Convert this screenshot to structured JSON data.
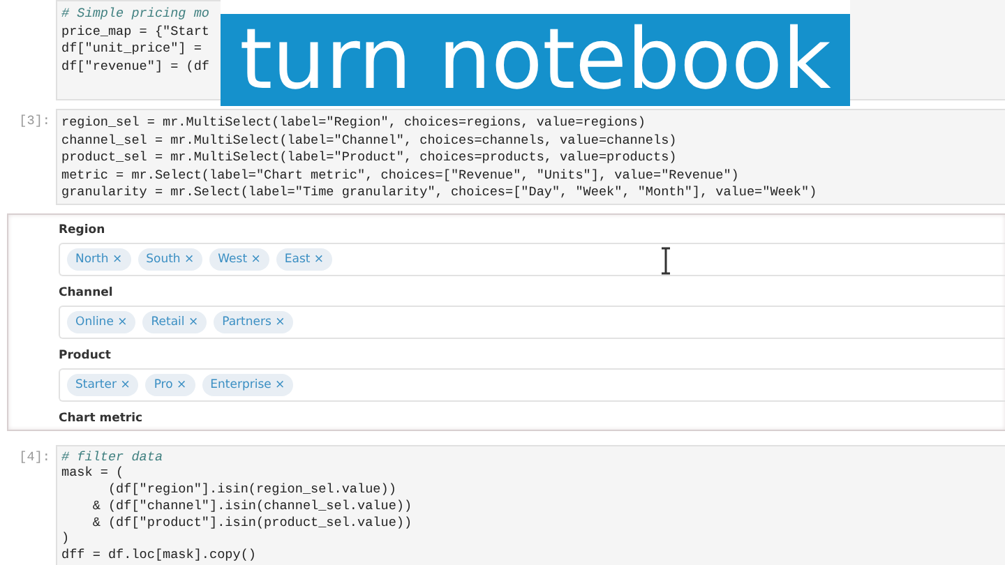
{
  "top_cell": {
    "lines": [
      {
        "kind": "comment",
        "text": "# Simple pricing mo"
      },
      {
        "text": "price_map = {\"Start"
      },
      {
        "text": "df[\"unit_price\"] ="
      },
      {
        "text": "df[\"revenue\"] = (df"
      }
    ]
  },
  "banner": {
    "text": "turn notebook"
  },
  "cells": [
    {
      "prompt": "[3]:",
      "lines": [
        {
          "text": "region_sel = mr.MultiSelect(label=\"Region\", choices=regions, value=regions)"
        },
        {
          "text": "channel_sel = mr.MultiSelect(label=\"Channel\", choices=channels, value=channels)"
        },
        {
          "text": "product_sel = mr.MultiSelect(label=\"Product\", choices=products, value=products)"
        },
        {
          "text": "metric = mr.Select(label=\"Chart metric\", choices=[\"Revenue\", \"Units\"], value=\"Revenue\")"
        },
        {
          "text": "granularity = mr.Select(label=\"Time granularity\", choices=[\"Day\", \"Week\", \"Month\"], value=\"Week\")"
        }
      ]
    }
  ],
  "widgets": [
    {
      "label": "Region",
      "chips": [
        "North",
        "South",
        "West",
        "East"
      ]
    },
    {
      "label": "Channel",
      "chips": [
        "Online",
        "Retail",
        "Partners"
      ]
    },
    {
      "label": "Product",
      "chips": [
        "Starter",
        "Pro",
        "Enterprise"
      ]
    },
    {
      "label": "Chart metric"
    }
  ],
  "chip_remove": "×",
  "after_cells": [
    {
      "prompt": "[4]:",
      "lines": [
        {
          "kind": "comment",
          "text": "# filter data"
        },
        {
          "text": "mask = ("
        },
        {
          "text": "      (df[\"region\"].isin(region_sel.value))"
        },
        {
          "text": "    & (df[\"channel\"].isin(channel_sel.value))"
        },
        {
          "text": "    & (df[\"product\"].isin(product_sel.value))"
        },
        {
          "text": ")"
        },
        {
          "text": "dff = df.loc[mask].copy()"
        }
      ]
    }
  ]
}
